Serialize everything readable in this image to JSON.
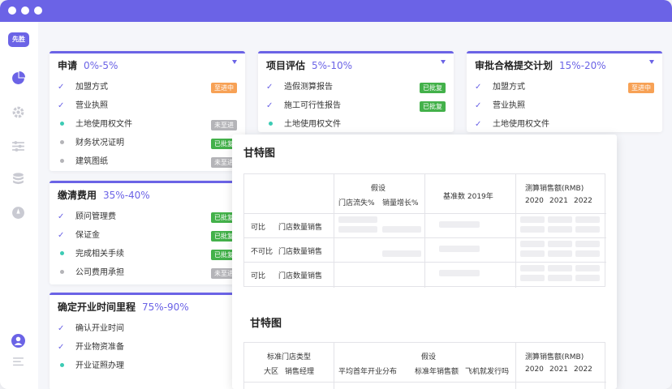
{
  "app": {
    "logo": "先胜"
  },
  "colors": {
    "accent": "#6b63e6",
    "orange": "#f7a155",
    "green": "#43b14a",
    "gray": "#b4b4b8",
    "teal": "#3ccbb4"
  },
  "sidebar": {
    "icons": [
      "pie-chart-icon",
      "gear-icon",
      "sliders-icon",
      "database-icon",
      "compass-icon",
      "user-icon",
      "list-icon"
    ]
  },
  "cards": [
    {
      "title": "申请",
      "pct": "0%-5%",
      "items": [
        {
          "label": "加盟方式",
          "mark": "check",
          "badge": "至进中",
          "badge_color": "orange"
        },
        {
          "label": "营业执照",
          "mark": "check",
          "badge": "",
          "badge_color": ""
        },
        {
          "label": "土地使用权文件",
          "mark": "teal",
          "badge": "未至进",
          "badge_color": "gray"
        },
        {
          "label": "财务状况证明",
          "mark": "gray",
          "badge": "已批复",
          "badge_color": "green"
        },
        {
          "label": "建筑图纸",
          "mark": "gray",
          "badge": "未至进",
          "badge_color": "gray"
        }
      ]
    },
    {
      "title": "项目评估",
      "pct": "5%-10%",
      "items": [
        {
          "label": "造假测算报告",
          "mark": "check",
          "badge": "已批复",
          "badge_color": "green"
        },
        {
          "label": "施工可行性报告",
          "mark": "check",
          "badge": "已批复",
          "badge_color": "green"
        },
        {
          "label": "土地使用权文件",
          "mark": "teal",
          "badge": "",
          "badge_color": ""
        }
      ]
    },
    {
      "title": "审批合格提交计划",
      "pct": "15%-20%",
      "items": [
        {
          "label": "加盟方式",
          "mark": "check",
          "badge": "至进中",
          "badge_color": "orange"
        },
        {
          "label": "营业执照",
          "mark": "check",
          "badge": "",
          "badge_color": ""
        },
        {
          "label": "土地使用权文件",
          "mark": "check",
          "badge": "",
          "badge_color": ""
        }
      ]
    },
    {
      "title": "缴清费用",
      "pct": "35%-40%",
      "items": [
        {
          "label": "顾问管理费",
          "mark": "check",
          "badge": "已批复",
          "badge_color": "green"
        },
        {
          "label": "保证金",
          "mark": "check",
          "badge": "已批复",
          "badge_color": "green"
        },
        {
          "label": "完成相关手续",
          "mark": "teal",
          "badge": "已批复",
          "badge_color": "green"
        },
        {
          "label": "公司费用承担",
          "mark": "gray",
          "badge": "未至进",
          "badge_color": "gray"
        }
      ]
    },
    {
      "title": "确定开业时间里程",
      "pct": "75%-90%",
      "items": [
        {
          "label": "确认开业时间",
          "mark": "check",
          "badge": "",
          "badge_color": ""
        },
        {
          "label": "开业物资准备",
          "mark": "check",
          "badge": "",
          "badge_color": ""
        },
        {
          "label": "开业证照办理",
          "mark": "teal",
          "badge": "",
          "badge_color": ""
        }
      ]
    }
  ],
  "gantt1": {
    "title": "甘特图",
    "header": {
      "assume": "假设",
      "assume_sub1": "门店流失%",
      "assume_sub2": "销量增长%",
      "base": "基准数 2019年",
      "forecast": "测算销售额(RMB)",
      "years": [
        "2020",
        "2021",
        "2022"
      ]
    },
    "rows": [
      {
        "tag": "可比",
        "label": "门店数量销售"
      },
      {
        "tag": "不可比",
        "label": "门店数量销售"
      },
      {
        "tag": "可比",
        "label": "门店数量销售"
      }
    ]
  },
  "gantt2": {
    "title": "甘特图",
    "header": {
      "type": "标准门店类型",
      "col1": "大区",
      "col2": "销售经理",
      "assume": "假设",
      "sub1": "平均首年开业分布",
      "sub2": "标准年销售额",
      "sub3": "飞机就发行吗",
      "forecast": "测算销售额(RMB)",
      "years": [
        "2020",
        "2021",
        "2022"
      ]
    }
  }
}
